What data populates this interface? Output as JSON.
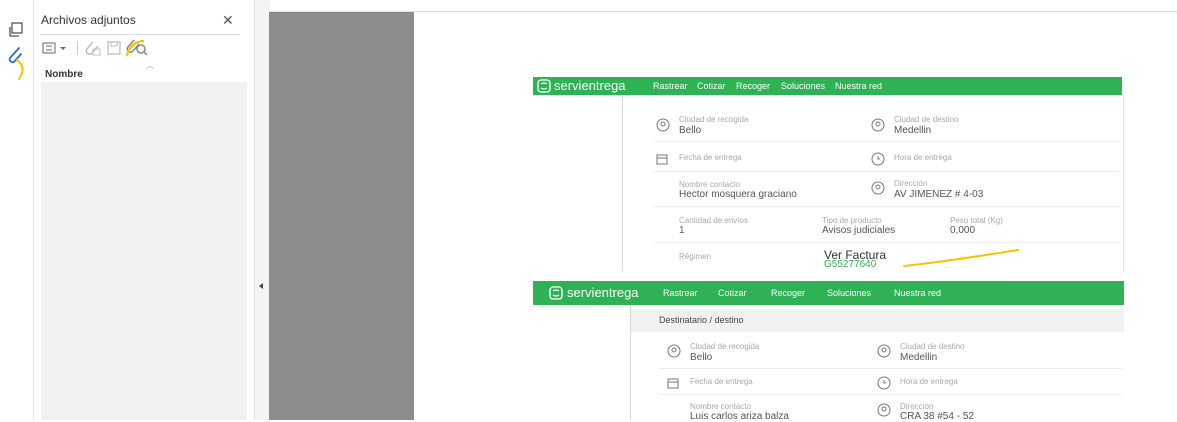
{
  "panel": {
    "title": "Archivos adjuntos",
    "column_header": "Nombre"
  },
  "shot1": {
    "brand": "servientrega",
    "nav": [
      "Rastrear",
      "Cotizar",
      "Recoger",
      "Soluciones",
      "Nuestra red"
    ],
    "ciudad_recogida_label": "Ciudad de recogida",
    "ciudad_recogida": "Bello",
    "ciudad_destino_label": "Ciudad de destino",
    "ciudad_destino": "Medellin",
    "fecha_entrega_label": "Fecha de entrega",
    "hora_entrega_label": "Hora de entrega",
    "nombre_contacto_label": "Nombre contacto",
    "nombre_contacto": "Hector mosquera graciano",
    "direccion_label": "Dirección",
    "direccion": "AV JIMENEZ # 4-03",
    "cantidad_label": "Cantidad de envíos",
    "cantidad": "1",
    "tipo_producto_label": "Tipo de producto",
    "tipo_producto": "Avisos judiciales",
    "peso_label": "Peso total (Kg)",
    "peso": "0,000",
    "regimen_label": "Régimen",
    "ver_factura": "Ver Factura",
    "factura_num": "G55277640"
  },
  "shot2": {
    "brand": "servientrega",
    "nav": [
      "Rastrear",
      "Cotizar",
      "Recoger",
      "Soluciones",
      "Nuestra red"
    ],
    "section_title": "Destinatario / destino",
    "ciudad_recogida_label": "Ciudad de recogida",
    "ciudad_recogida": "Bello",
    "ciudad_destino_label": "Ciudad de destino",
    "ciudad_destino": "Medellin",
    "fecha_entrega_label": "Fecha de entrega",
    "hora_entrega_label": "Hora de entrega",
    "nombre_contacto_label": "Nombre contacto",
    "nombre_contacto": "Luis carlos ariza balza",
    "direccion_label": "Dirección",
    "direccion": "CRA 38 #54 - 52"
  },
  "colors": {
    "brand_green": "#2eb255",
    "annotation_yellow": "#f5c400"
  }
}
